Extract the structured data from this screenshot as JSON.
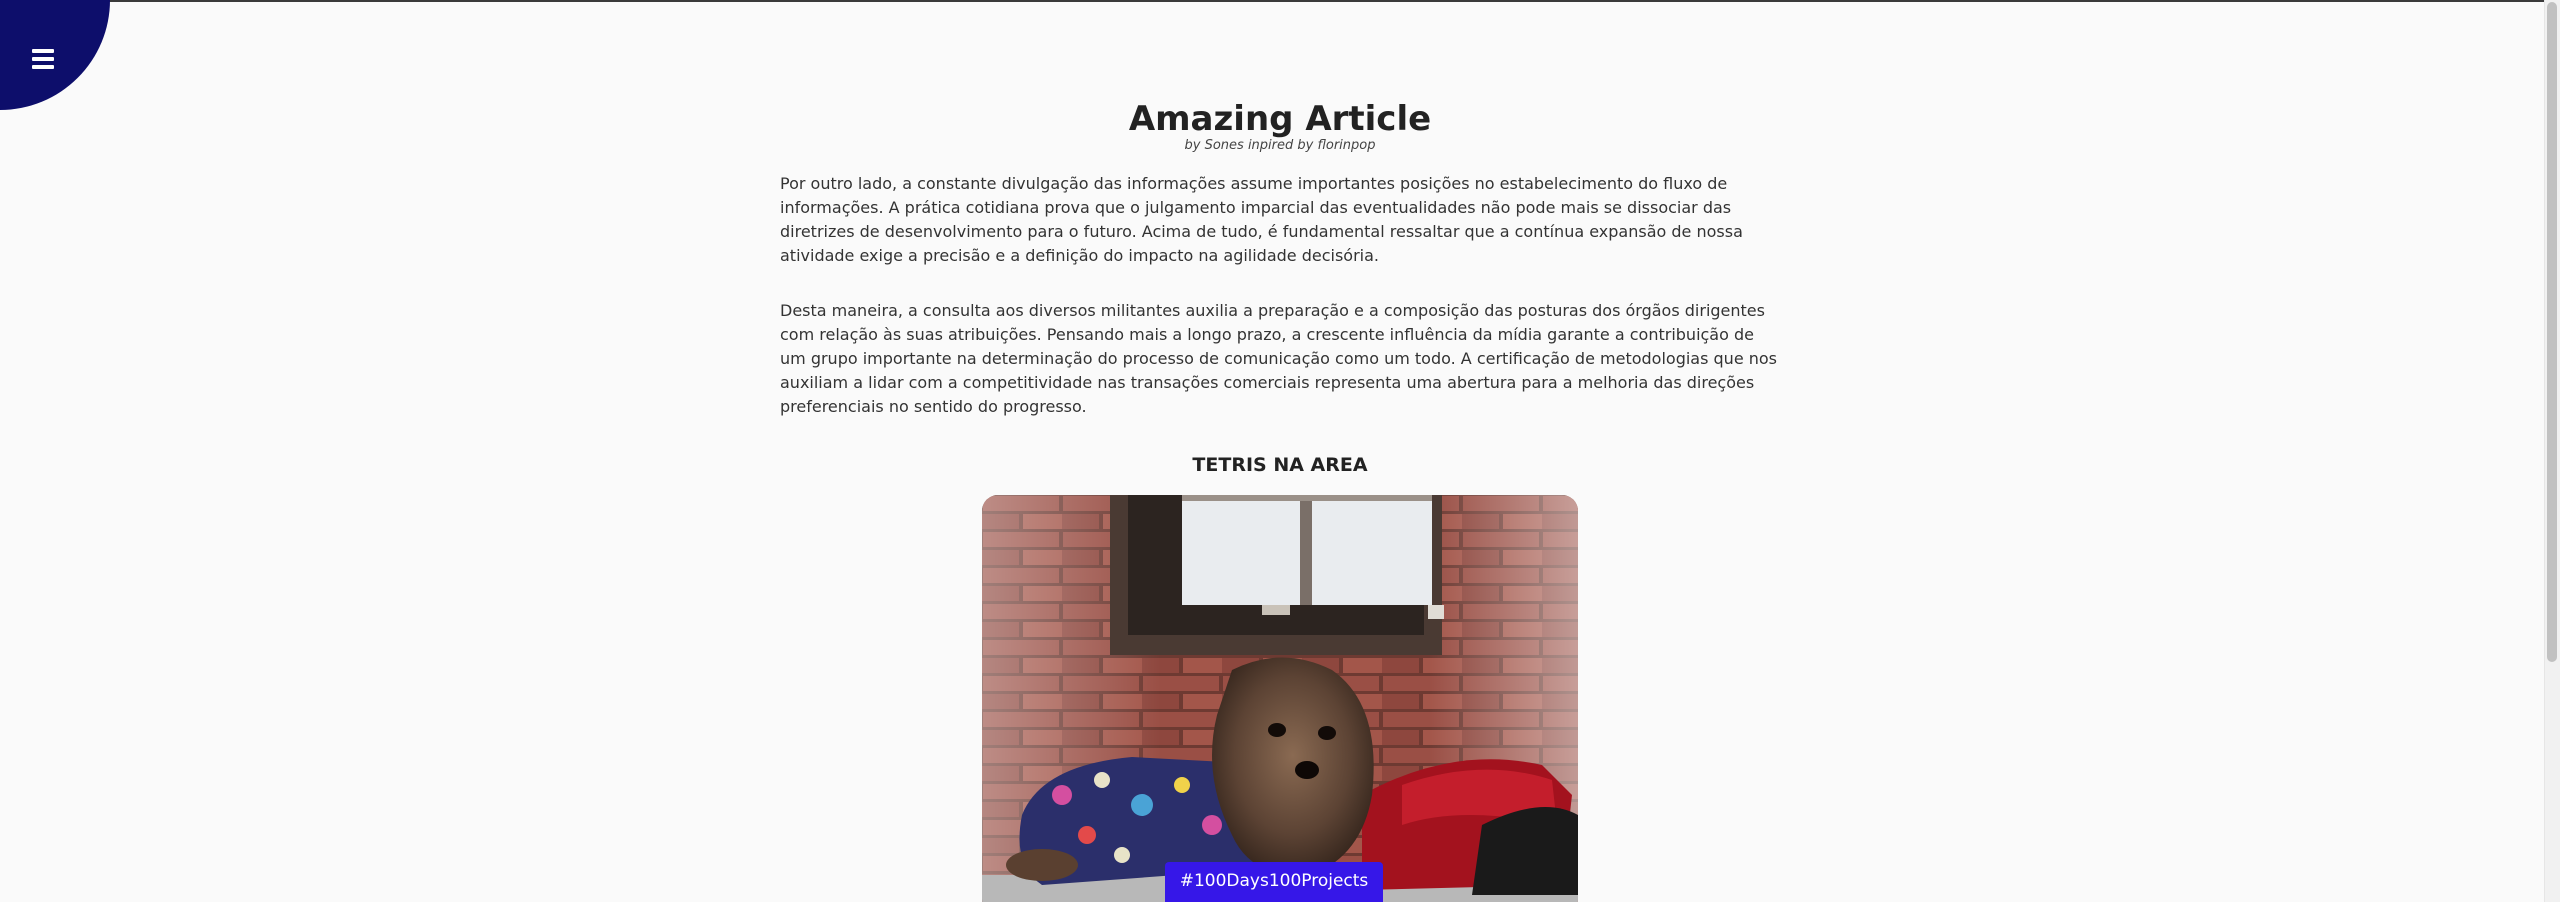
{
  "menu": {
    "icon": "hamburger-icon",
    "color": "#0d0e6b"
  },
  "article": {
    "title": "Amazing Article",
    "byline": "by Sones inpired by florinpop",
    "paragraphs": [
      "Por outro lado, a constante divulgação das informações assume importantes posições no estabelecimento do fluxo de informações. A prática cotidiana prova que o julgamento imparcial das eventualidades não pode mais se dissociar das diretrizes de desenvolvimento para o futuro. Acima de tudo, é fundamental ressaltar que a contínua expansão de nossa atividade exige a precisão e a definição do impacto na agilidade decisória.",
      "Desta maneira, a consulta aos diversos militantes auxilia a preparação e a composição das posturas dos órgãos dirigentes com relação às suas atribuições. Pensando mais a longo prazo, a crescente influência da mídia garante a contribuição de um grupo importante na determinação do processo de comunicação como um todo. A certificação de metodologias que nos auxiliam a lidar com a competitividade nas transações comerciais representa uma abertura para a melhoria das direções preferenciais no sentido do progresso."
    ],
    "section_heading": "TETRIS NA AREA"
  },
  "badge": {
    "label": "#100Days100Projects",
    "color": "#3617e8"
  }
}
